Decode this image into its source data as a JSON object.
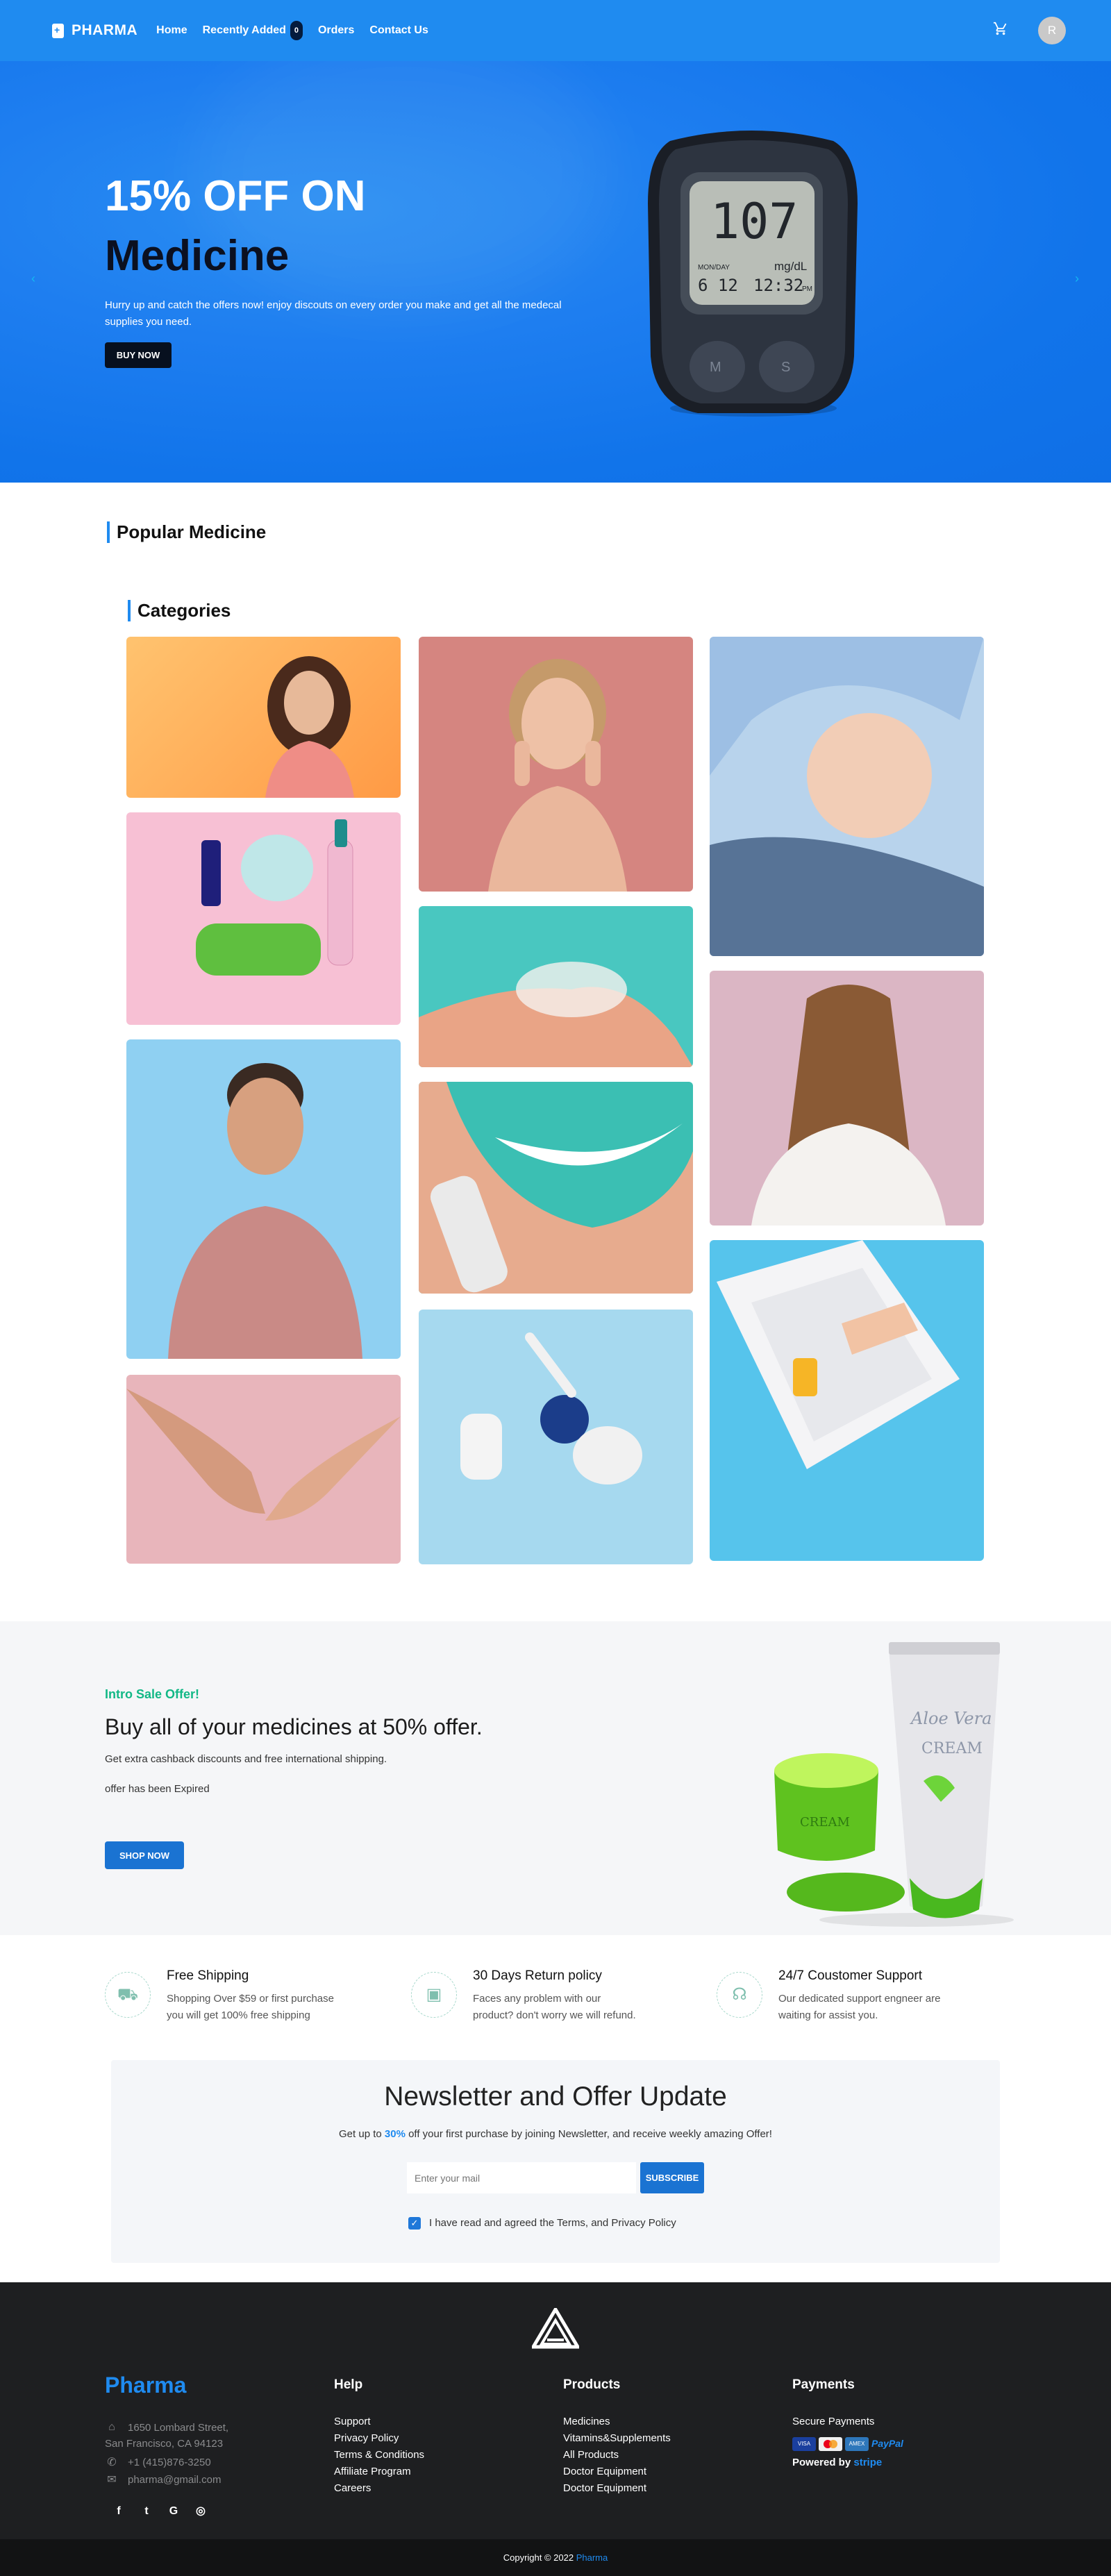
{
  "nav": {
    "brand": "PHARMA",
    "links": [
      "Home",
      "Recently Added",
      "Orders",
      "Contact Us"
    ],
    "recent_badge": "0",
    "avatar_initial": "R"
  },
  "hero": {
    "headline1": "15% OFF ON",
    "headline2": "Medicine",
    "description": "Hurry up and catch the offers now! enjoy discouts on every order you make and get all the medecal supplies you need.",
    "button": "BUY NOW",
    "meter_reading": "107",
    "meter_date_label": "MON/DAY",
    "meter_date": "6 12",
    "meter_unit": "mg/dL",
    "meter_time": "12:32",
    "meter_pm": "PM",
    "meter_btn_m": "M",
    "meter_btn_s": "S"
  },
  "popular": {
    "title": "Popular Medicine"
  },
  "categories": {
    "title": "Categories"
  },
  "promo": {
    "kicker": "Intro Sale Offer!",
    "title": "Buy all of your medicines at 50% offer.",
    "line1": "Get extra cashback discounts and free international shipping.",
    "line2": "offer has been Expired",
    "button": "SHOP NOW",
    "tube_brand": "Aloe Vera",
    "tube_label": "CREAM",
    "jar_label": "CREAM"
  },
  "features": [
    {
      "title": "Free Shipping",
      "text": "Shopping Over $59 or first purchase you will get 100% free shipping"
    },
    {
      "title": "30 Days Return policy",
      "text": "Faces any problem with our product? don't worry we will refund."
    },
    {
      "title": "24/7 Coustomer Support",
      "text": "Our dedicated support engneer are waiting for assist you."
    }
  ],
  "newsletter": {
    "title": "Newsletter and Offer Update",
    "sub_pre": "Get up to ",
    "sub_pct": "30%",
    "sub_post": " off your first purchase by joining Newsletter, and receive weekly amazing Offer!",
    "placeholder": "Enter your mail",
    "button": "SUBSCRIBE",
    "agree": "I have read and agreed the Terms, and Privacy Policy"
  },
  "footer": {
    "brand": "Pharma",
    "address1": "1650 Lombard Street,",
    "address2": "San Francisco, CA 94123",
    "phone": "+1 (415)876-3250",
    "email": "pharma@gmail.com",
    "help_title": "Help",
    "help": [
      "Support",
      "Privacy Policy",
      "Terms & Conditions",
      "Affiliate Program",
      "Careers"
    ],
    "products_title": "Products",
    "products": [
      "Medicines",
      "Vitamins&Supplements",
      "All Products",
      "Doctor Equipment",
      "Doctor Equipment"
    ],
    "payments_title": "Payments",
    "secure": "Secure Payments",
    "powered_pre": "Powered by ",
    "powered_brand": "stripe",
    "card_visa": "VISA",
    "card_amex": "AMEX",
    "paypal": "PayPal"
  },
  "copyright": {
    "pre": "Copyright © 2022 ",
    "brand": "Pharma"
  },
  "colors": {
    "primary": "#1f8bf0",
    "button": "#1a73d2",
    "accent_green": "#12b886",
    "footer_bg": "#1e1f21"
  },
  "icons": [
    "cart-icon",
    "chevron-left-icon",
    "chevron-right-icon",
    "truck-icon",
    "wallet-icon",
    "headset-icon",
    "home-icon",
    "phone-icon",
    "mail-icon",
    "facebook-icon",
    "twitter-icon",
    "google-icon",
    "instagram-icon",
    "check-icon"
  ]
}
